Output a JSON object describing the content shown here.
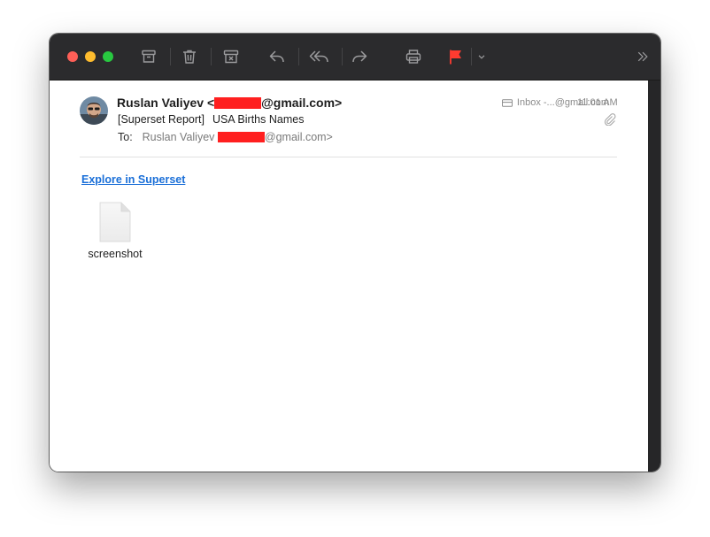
{
  "colors": {
    "toolbar_bg": "#2b2b2d",
    "flag": "#ff3b30",
    "link": "#1a6fd8",
    "redaction": "#ff1f1f"
  },
  "toolbar": {
    "buttons": [
      {
        "name": "archive",
        "icon": "archive-icon"
      },
      {
        "name": "delete",
        "icon": "trash-icon"
      },
      {
        "name": "junk",
        "icon": "junk-icon"
      },
      {
        "name": "reply",
        "icon": "reply-icon"
      },
      {
        "name": "reply-all",
        "icon": "reply-all-icon"
      },
      {
        "name": "forward",
        "icon": "forward-icon"
      },
      {
        "name": "print",
        "icon": "printer-icon"
      },
      {
        "name": "flag",
        "icon": "flag-icon"
      },
      {
        "name": "flag-menu",
        "icon": "chevron-down-icon"
      },
      {
        "name": "more",
        "icon": "double-chevron-right-icon"
      }
    ]
  },
  "message": {
    "sender_name": "Ruslan Valiyev <",
    "sender_domain": "@gmail.com>",
    "subject_prefix": "[Superset Report]",
    "subject_title": "USA Births Names",
    "to_label": "To:",
    "to_name": "Ruslan Valiyev",
    "to_domain": "@gmail.com>",
    "mailbox": "Inbox -...@gmail.com",
    "time": "11:01 AM",
    "has_attachment_icon": "paperclip-icon"
  },
  "body": {
    "link_text": "Explore in Superset",
    "attachment": {
      "name": "screenshot",
      "icon": "document-icon"
    }
  }
}
